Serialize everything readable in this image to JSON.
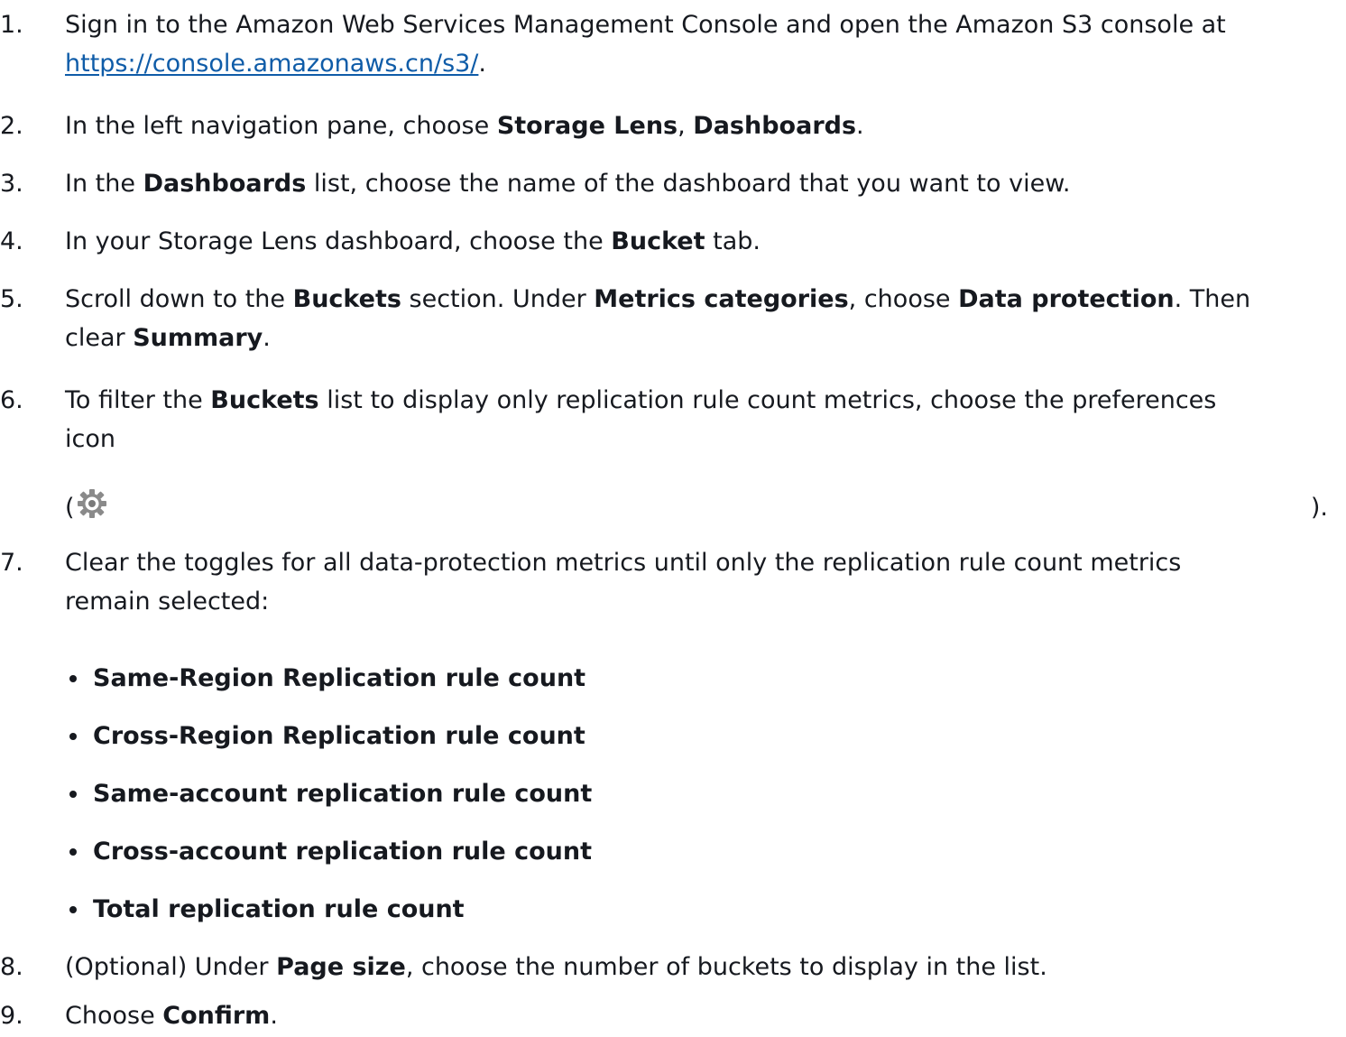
{
  "steps": [
    {
      "num": "1.",
      "pre": "Sign in to the Amazon Web Services Management Console and open the Amazon S3 console at",
      "link": "https://console.amazonaws.cn/s3/",
      "post": "."
    },
    {
      "num": "2.",
      "t1": "In the left navigation pane, choose ",
      "b1": "Storage Lens",
      "t2": ", ",
      "b2": "Dashboards",
      "t3": "."
    },
    {
      "num": "3.",
      "t1": "In the ",
      "b1": "Dashboards",
      "t2": " list, choose the name of the dashboard that you want to view."
    },
    {
      "num": "4.",
      "t1": "In your Storage Lens dashboard, choose the ",
      "b1": "Bucket",
      "t2": " tab."
    },
    {
      "num": "5.",
      "t1": "Scroll down to the ",
      "b1": "Buckets",
      "t2": " section. Under ",
      "b2": "Metrics categories",
      "t3": ", choose ",
      "b3": "Data protection",
      "t4": ". Then",
      "t5": "clear ",
      "b4": "Summary",
      "t6": "."
    },
    {
      "num": "6.",
      "t1": "To filter the ",
      "b1": "Buckets",
      "t2": " list to display only replication rule count metrics, choose the preferences",
      "t3": "icon",
      "open": "(",
      "close": ")."
    },
    {
      "num": "7.",
      "t1": "Clear the toggles for all data-protection metrics until only the replication rule count metrics",
      "t2": "remain selected:"
    },
    {
      "num": "8.",
      "t1": "(Optional) Under ",
      "b1": "Page size",
      "t2": ", choose the number of buckets to display in the list."
    },
    {
      "num": "9.",
      "t1": "Choose ",
      "b1": "Confirm",
      "t2": "."
    }
  ],
  "bullets": [
    "Same-Region Replication rule count",
    "Cross-Region Replication rule count",
    "Same-account replication rule count",
    "Cross-account replication rule count",
    "Total replication rule count"
  ],
  "icons": {
    "preferences": "gear-icon"
  }
}
